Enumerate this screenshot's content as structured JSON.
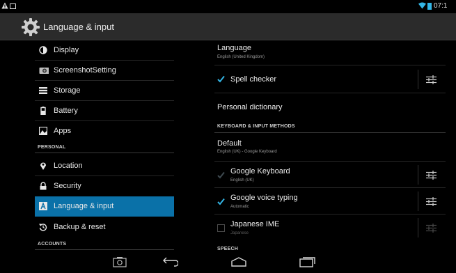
{
  "status_bar": {
    "time": "07:1",
    "icons": [
      "warning-icon",
      "notification-icon",
      "wifi-icon",
      "battery-icon"
    ],
    "battery_color": "#33b5e5"
  },
  "action_bar": {
    "title": "Language & input",
    "icon": "settings-gear-icon"
  },
  "left_panel": {
    "items": [
      {
        "label": "Display",
        "icon": "display-icon"
      },
      {
        "label": "ScreenshotSetting",
        "icon": "camera-icon"
      },
      {
        "label": "Storage",
        "icon": "storage-icon"
      },
      {
        "label": "Battery",
        "icon": "battery-icon"
      },
      {
        "label": "Apps",
        "icon": "apps-icon"
      }
    ],
    "personal_header": "PERSONAL",
    "personal_items": [
      {
        "label": "Location",
        "icon": "location-pin-icon"
      },
      {
        "label": "Security",
        "icon": "lock-icon"
      },
      {
        "label": "Language & input",
        "icon": "language-icon",
        "selected": true
      },
      {
        "label": "Backup & reset",
        "icon": "backup-icon"
      }
    ],
    "accounts_header": "ACCOUNTS",
    "selected_color": "#0a71a8"
  },
  "right_panel": {
    "language": {
      "title": "Language",
      "summary": "English (United Kingdom)"
    },
    "spell_checker": {
      "title": "Spell checker",
      "checked": true
    },
    "personal_dictionary": {
      "title": "Personal dictionary"
    },
    "keyboard_header": "KEYBOARD & INPUT METHODS",
    "default": {
      "title": "Default",
      "summary": "English (UK) - Google Keyboard"
    },
    "methods": [
      {
        "title": "Google Keyboard",
        "summary": "English (UK)",
        "checked": true,
        "enabled": false
      },
      {
        "title": "Google voice typing",
        "summary": "Automatic",
        "checked": true,
        "enabled": true
      },
      {
        "title": "Japanese IME",
        "summary": "Japanese",
        "checked": false,
        "enabled": true
      }
    ],
    "speech_header": "SPEECH",
    "accent_color": "#33b5e5"
  },
  "nav_bar": {
    "buttons": [
      "screenshot-icon",
      "back-icon",
      "home-icon",
      "recent-apps-icon"
    ]
  }
}
